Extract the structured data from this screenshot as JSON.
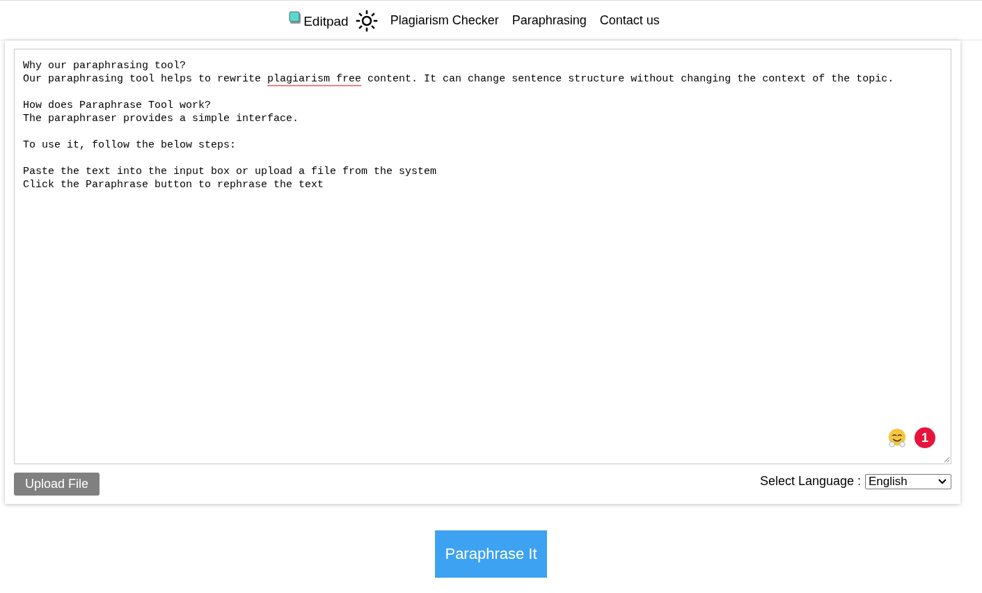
{
  "nav": {
    "brand": "Editpad",
    "links": [
      "Plagiarism Checker",
      "Paraphrasing",
      "Contact us"
    ]
  },
  "editor": {
    "paragraphs": [
      [
        [
          {
            "text": "Why our paraphrasing tool?",
            "flagged": false
          }
        ],
        [
          {
            "text": "Our paraphrasing tool helps to rewrite ",
            "flagged": false
          },
          {
            "text": "plagiarism free",
            "flagged": true
          },
          {
            "text": " content. It can change sentence structure without changing the context of the topic.",
            "flagged": false
          }
        ]
      ],
      [
        [
          {
            "text": "How does Paraphrase Tool work?",
            "flagged": false
          }
        ],
        [
          {
            "text": "The paraphraser provides a simple interface.",
            "flagged": false
          }
        ]
      ],
      [
        [
          {
            "text": "To use it, follow the below steps:",
            "flagged": false
          }
        ]
      ],
      [
        [
          {
            "text": "Paste the text into the input box or upload a file from the system",
            "flagged": false
          }
        ],
        [
          {
            "text": "Click the Paraphrase button to rephrase the text",
            "flagged": false
          }
        ]
      ]
    ],
    "badge": "1"
  },
  "upload_button": "Upload File",
  "language": {
    "label": "Select Language :",
    "value": "English"
  },
  "submit_button": "Paraphrase It"
}
